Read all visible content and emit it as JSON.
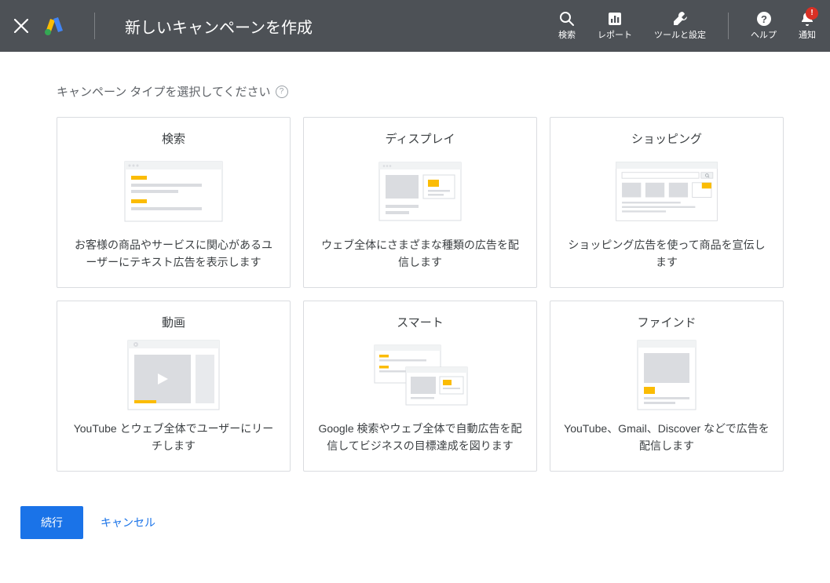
{
  "header": {
    "title": "新しいキャンペーンを作成",
    "nav": {
      "search": "検索",
      "reports": "レポート",
      "tools": "ツールと設定",
      "help": "ヘルプ",
      "notifications": "通知"
    }
  },
  "main": {
    "section_title": "キャンペーン タイプを選択してください",
    "cards": [
      {
        "title": "検索",
        "desc": "お客様の商品やサービスに関心があるユーザーにテキスト広告を表示します"
      },
      {
        "title": "ディスプレイ",
        "desc": "ウェブ全体にさまざまな種類の広告を配信します"
      },
      {
        "title": "ショッピング",
        "desc": "ショッピング広告を使って商品を宣伝します"
      },
      {
        "title": "動画",
        "desc": "YouTube とウェブ全体でユーザーにリーチします"
      },
      {
        "title": "スマート",
        "desc": "Google 検索やウェブ全体で自動広告を配信してビジネスの目標達成を図ります"
      },
      {
        "title": "ファインド",
        "desc": "YouTube、Gmail、Discover などで広告を配信します"
      }
    ]
  },
  "footer": {
    "continue": "続行",
    "cancel": "キャンセル"
  },
  "colors": {
    "accent": "#1a73e8",
    "warning": "#d93025"
  }
}
